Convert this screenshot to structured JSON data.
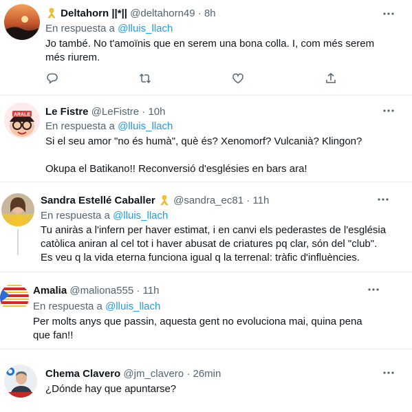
{
  "colors": {
    "accent": "#1d9bf0",
    "text_primary": "#0f1419",
    "text_secondary": "#536471",
    "divider": "#ebeef0",
    "ribbon": "#f4c430"
  },
  "reply_prefix": "En respuesta a",
  "tweets": [
    {
      "name": "Deltahorn ||*||",
      "has_ribbon": true,
      "handle": "@deltahorn49",
      "time": "8h",
      "reply_to": "@lluis_llach",
      "text": "Jo també. No t'amoïnis que en serem una bona colla. I, com més serem més riurem.",
      "actions": [
        "reply-icon",
        "retweet-icon",
        "like-icon",
        "share-icon"
      ]
    },
    {
      "name": "Le Fistre",
      "handle": "@LeFistre",
      "time": "10h",
      "reply_to": "@lluis_llach",
      "text_lines": [
        "Si el seu amor \"no és humà\", què és? Xenomorf? Vulcanià? Klingon?",
        "Okupa el Batikano!! Reconversió d'esglésies en bars ara!"
      ]
    },
    {
      "name": "Sandra Estellé Caballer",
      "has_ribbon": true,
      "handle": "@sandra_ec81",
      "time": "11h",
      "reply_to": "@lluis_llach",
      "text": "Tu aniràs a l'infern per haver estimat, i en canvi els pederastes de l'església catòlica aniran al cel tot i haver abusat de criatures pq clar, són del \"club\". Es veu q la vida eterna funciona igual q la terrenal: tràfic d'influències."
    },
    {
      "name": "Amalia",
      "handle": "@maliona555",
      "time": "11h",
      "reply_to": "@lluis_llach",
      "text": "Per molts anys que passin, aquesta gent no evoluciona mai, quina pena que fan!!"
    },
    {
      "name": "Chema Clavero",
      "handle": "@jm_clavero",
      "time": "26min",
      "text": "¿Dónde hay que apuntarse?"
    }
  ]
}
